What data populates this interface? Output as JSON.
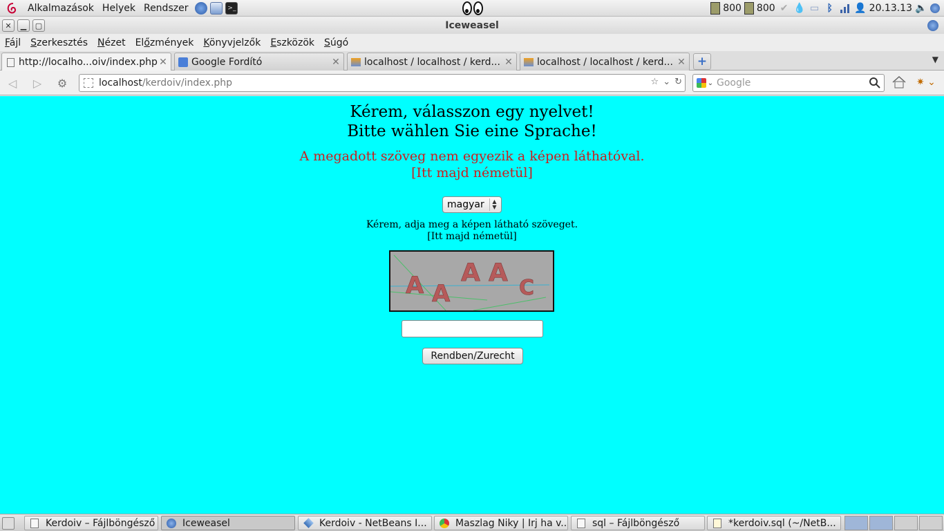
{
  "top_panel": {
    "menus": [
      "Alkalmazások",
      "Helyek",
      "Rendszer"
    ],
    "tray": {
      "cpu1": "800",
      "cpu2": "800",
      "clock": "20.13.13"
    }
  },
  "window": {
    "title": "Iceweasel"
  },
  "menubar": [
    {
      "pre": "",
      "key": "F",
      "post": "ájl"
    },
    {
      "pre": "",
      "key": "S",
      "post": "zerkesztés"
    },
    {
      "pre": "",
      "key": "N",
      "post": "ézet"
    },
    {
      "pre": "El",
      "key": "ő",
      "post": "zmények"
    },
    {
      "pre": "",
      "key": "K",
      "post": "önyvjelzők"
    },
    {
      "pre": "",
      "key": "E",
      "post": "szközök"
    },
    {
      "pre": "",
      "key": "S",
      "post": "úgó"
    }
  ],
  "tabs": [
    {
      "label": "http://localho...oiv/index.php",
      "icon": "blank-page-icon"
    },
    {
      "label": "Google Fordító",
      "icon": "google-translate-icon"
    },
    {
      "label": "localhost / localhost / kerd...",
      "icon": "phpmyadmin-icon"
    },
    {
      "label": "localhost / localhost / kerd...",
      "icon": "phpmyadmin-icon"
    }
  ],
  "navbar": {
    "url_host": "localhost",
    "url_path": "/kerdoiv/index.php",
    "search_placeholder": "Google"
  },
  "page": {
    "heading_hu": "Kérem, válasszon egy nyelvet!",
    "heading_de": "Bitte wählen Sie eine Sprache!",
    "error_hu": "A megadott szöveg nem egyezik a képen láthatóval.",
    "error_de": "[Itt majd németül]",
    "language_selected": "magyar",
    "hint_hu": "Kérem, adja meg a képen látható szöveget.",
    "hint_de": "[Itt majd németül]",
    "captcha_text": [
      "A",
      "A",
      "A",
      "A",
      "C"
    ],
    "answer_value": "",
    "submit_label": "Rendben/Zurecht"
  },
  "taskbar": [
    {
      "label": "Kerdoiv – Fájlböngésző",
      "icon": "file-manager-icon"
    },
    {
      "label": "Iceweasel",
      "icon": "iceweasel-icon",
      "active": true
    },
    {
      "label": "Kerdoiv - NetBeans I...",
      "icon": "netbeans-icon"
    },
    {
      "label": "Maszlag Niky | Irj ha v...",
      "icon": "chrome-icon"
    },
    {
      "label": "sql – Fájlböngésző",
      "icon": "file-manager-icon"
    },
    {
      "label": "*kerdoiv.sql (~/NetB...",
      "icon": "text-editor-icon"
    }
  ],
  "colors": {
    "page_bg": "#00ffff",
    "error": "#cc1d1d",
    "panel": "#dcdcdc"
  }
}
